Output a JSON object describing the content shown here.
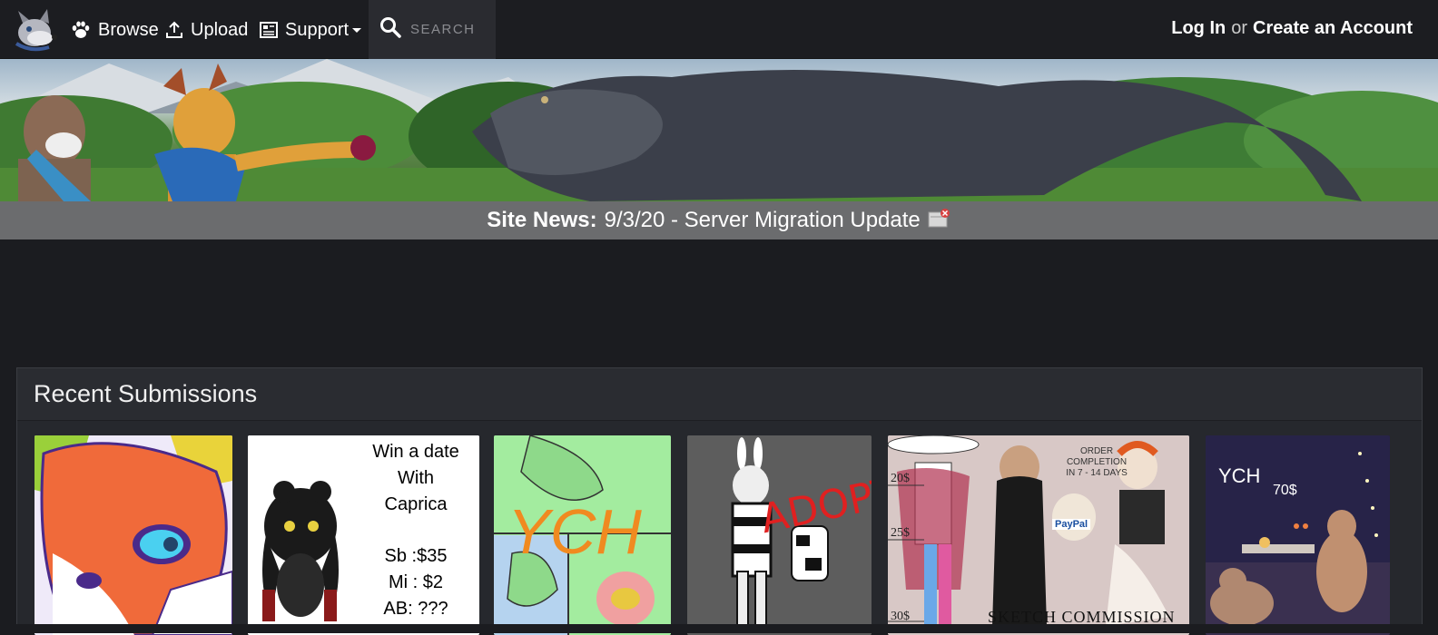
{
  "nav": {
    "browse_label": "Browse",
    "upload_label": "Upload",
    "support_label": "Support",
    "search_placeholder": "SEARCH",
    "login_label": "Log In",
    "or_label": "or",
    "create_account_label": "Create an Account"
  },
  "news": {
    "label": "Site News:",
    "text": "9/3/20 - Server Migration Update"
  },
  "recent": {
    "title": "Recent Submissions",
    "thumbs": [
      {
        "icon": "fox-portrait"
      },
      {
        "icon": "date-auction",
        "lines": [
          "Win a date",
          "With",
          "Caprica",
          "Sb :$35",
          "Mi : $2",
          "AB: ???"
        ]
      },
      {
        "icon": "ych-dragon",
        "text": "YCH"
      },
      {
        "icon": "adopt-bunny",
        "text": "ADOPT"
      },
      {
        "icon": "sketch-commission",
        "text_top": [
          "ORDER",
          "COMPLETION",
          "IN 7 - 14 DAYS"
        ],
        "prices": [
          "20$",
          "25$",
          "30$"
        ],
        "bottom": "SKETCH COMMISSION",
        "paypal": "PayPal"
      },
      {
        "icon": "ych-night-scene",
        "text": "YCH",
        "price": "70$"
      }
    ]
  },
  "colors": {
    "topnav_bg": "#1c1d21",
    "newsbar_bg": "#6b6c6e",
    "panel_bg": "#26282d"
  }
}
